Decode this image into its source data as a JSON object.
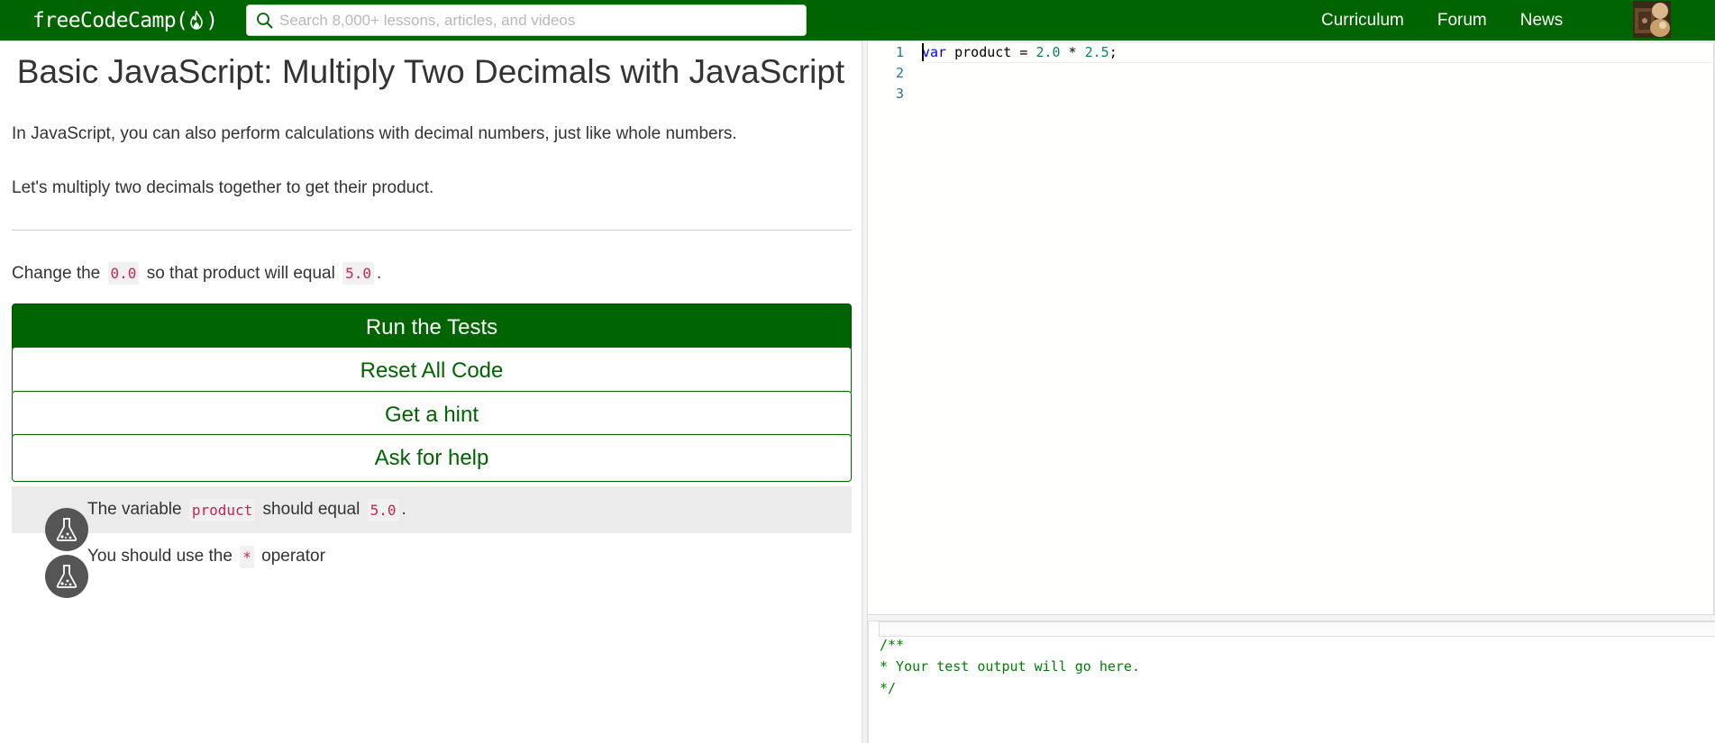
{
  "navbar": {
    "logo_text_before": "freeCodeCamp(",
    "logo_text_after": ")",
    "logo_icon": "flame-icon",
    "search_placeholder": "Search 8,000+ lessons, articles, and videos",
    "links": [
      "Curriculum",
      "Forum",
      "News"
    ],
    "colors": {
      "nav_bg": "#006400",
      "text": "#ffffff"
    }
  },
  "challenge": {
    "title": "Basic JavaScript: Multiply Two Decimals with JavaScript",
    "description_1": "In JavaScript, you can also perform calculations with decimal numbers, just like whole numbers.",
    "description_2": "Let's multiply two decimals together to get their product.",
    "instruction": {
      "prefix": "Change the ",
      "code_1": "0.0",
      "middle": " so that product will equal ",
      "code_2": "5.0",
      "suffix": "."
    }
  },
  "buttons": {
    "run_tests": "Run the Tests",
    "reset_code": "Reset All Code",
    "get_hint": "Get a hint",
    "ask_help": "Ask for help"
  },
  "tests": [
    {
      "prefix": "The variable ",
      "code": "product",
      "middle": " should equal ",
      "code_2": "5.0",
      "suffix": "."
    },
    {
      "prefix": "You should use the ",
      "code": "*",
      "suffix": " operator"
    }
  ],
  "editor": {
    "line_numbers": [
      "1",
      "2",
      "3"
    ],
    "line_1": {
      "keyword": "var",
      "ident": " product = ",
      "num_1": "2.0",
      "op": " * ",
      "num_2": "2.5",
      "end": ";"
    }
  },
  "output": {
    "lines": [
      "/**",
      "* Your test output will go here.",
      "*/"
    ]
  },
  "colors": {
    "primary_green": "#006400",
    "code_red": "#c7254e",
    "keyword_blue": "#0000ff",
    "number_green": "#098658",
    "comment_green": "#008000"
  }
}
